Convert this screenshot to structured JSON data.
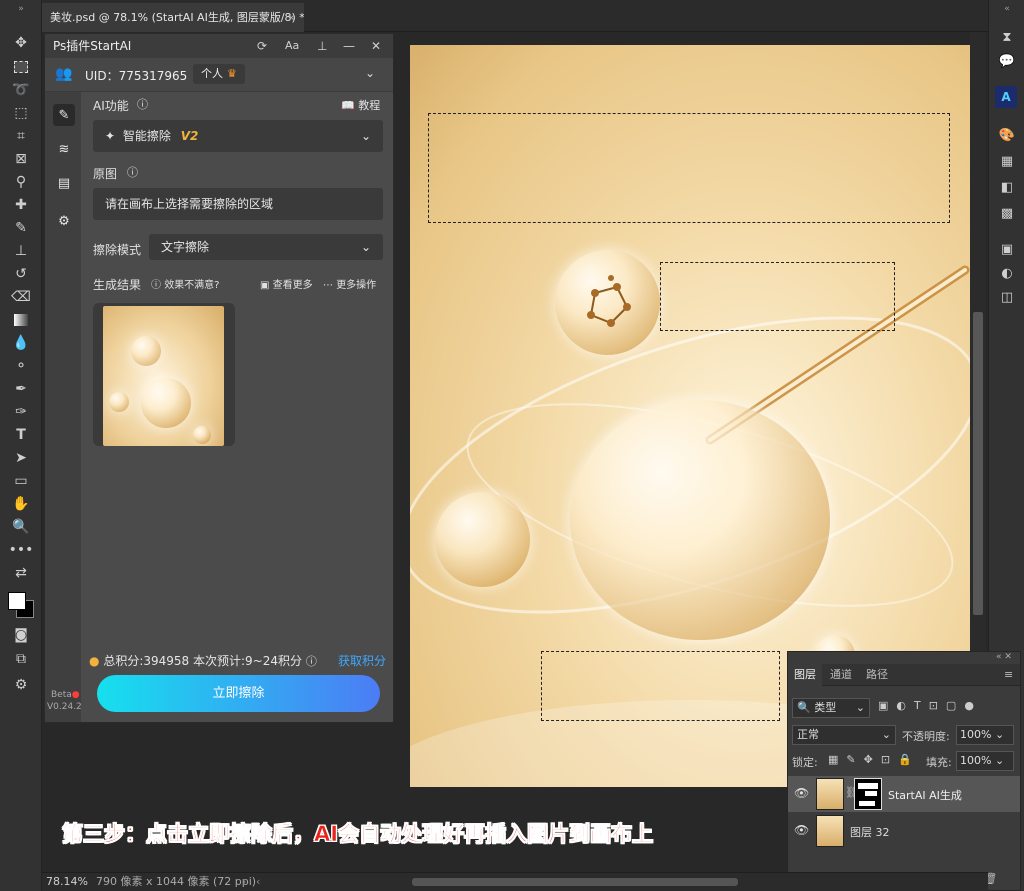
{
  "document_tab": {
    "title": "美妆.psd @ 78.1% (StartAI AI生成, 图层蒙版/8) *",
    "close": "×"
  },
  "plugin": {
    "title": "Ps插件StartAI",
    "header_icons": {
      "refresh": "C",
      "font": "Aa",
      "pin": "pin-icon",
      "minimize": "—",
      "close": "✕"
    },
    "uid": "UID：775317965",
    "account_type": "个人",
    "ai_function_label": "AI功能",
    "tutorial_label": "教程",
    "function_value": "智能擦除",
    "function_version": "V2",
    "original_label": "原图",
    "original_placeholder": "请在画布上选择需要擦除的区域",
    "erase_mode_label": "擦除模式",
    "erase_mode_value": "文字擦除",
    "result_label": "生成结果",
    "unsatisfied_label": "效果不满意?",
    "view_more_label": "查看更多",
    "more_actions_label": "更多操作",
    "points_text": "总积分:394958  本次预计:9~24积分",
    "get_points_label": "获取积分",
    "erase_button_label": "立即擦除",
    "beta_label": "Beta",
    "version_label": "V0.24.2"
  },
  "layers_panel": {
    "tabs": [
      "图层",
      "通道",
      "路径"
    ],
    "filter_kind": "类型",
    "blend_mode": "正常",
    "opacity_label": "不透明度:",
    "opacity_value": "100%",
    "lock_label": "锁定:",
    "fill_label": "填充:",
    "fill_value": "100%",
    "layers": [
      {
        "name": "StartAI AI生成",
        "selected": true
      },
      {
        "name": "图层 32",
        "selected": false
      }
    ]
  },
  "status": {
    "zoom": "78.14%",
    "doc_info": "790 像素 x 1044 像素 (72 ppi)"
  },
  "caption": "第三步：点击立即擦除后，AI会自动处理好再插入图片到画布上",
  "colors": {
    "accent_start": "#16e0ee",
    "accent_end": "#4c7cf5",
    "caption_red": "#e8231d",
    "link_blue": "#3fa8ff"
  }
}
